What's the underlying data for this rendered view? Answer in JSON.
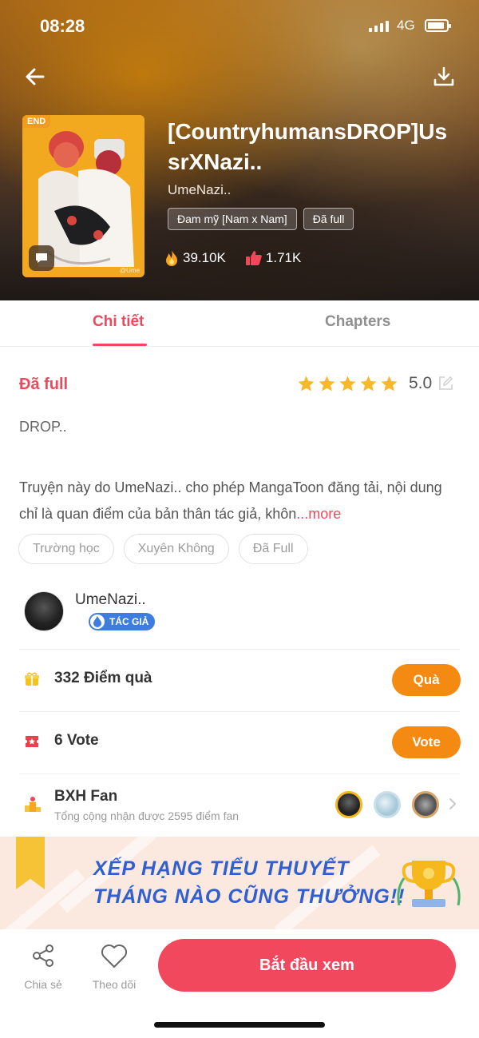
{
  "status_bar": {
    "time": "08:28",
    "network": "4G"
  },
  "header": {
    "title": "[CountryhumansDROP]UssrXNazi..",
    "author": "UmeNazi..",
    "cover_badge": "END",
    "cover_watermark": "@Ume",
    "tags": [
      "Đam mỹ [Nam x Nam]",
      "Đã full"
    ],
    "stats": {
      "views": "39.10K",
      "likes": "1.71K"
    }
  },
  "tabs": [
    {
      "label": "Chi tiết",
      "active": true
    },
    {
      "label": "Chapters",
      "active": false
    }
  ],
  "detail": {
    "status_label": "Đã full",
    "rating": {
      "stars": 5,
      "score": "5.0"
    },
    "description_short": "DROP..",
    "description_long": "Truyện này do UmeNazi.. cho phép MangaToon đăng tải, nội dung chỉ là quan điểm của bản thân tác giả, khôn",
    "more_label": "...more",
    "chips": [
      "Trường học",
      "Xuyên Không",
      "Đã Full"
    ]
  },
  "author_card": {
    "name": "UmeNazi..",
    "badge": "TÁC GIẢ"
  },
  "gift_row": {
    "label": "332 Điểm quà",
    "button": "Quà"
  },
  "vote_row": {
    "label": "6 Vote",
    "button": "Vote"
  },
  "fan_row": {
    "label": "BXH Fan",
    "sub": "Tổng cộng nhận được 2595 điểm fan"
  },
  "banner": {
    "line1": "XẾP HẠNG TIỂU THUYẾT",
    "line2": "THÁNG NÀO CŨNG THƯỞNG!!"
  },
  "bottom_bar": {
    "share": "Chia sẻ",
    "follow": "Theo dõi",
    "start": "Bắt đầu xem"
  },
  "colors": {
    "accent": "#f0485a",
    "orange": "#f58a12",
    "blue": "#2f5fd1"
  }
}
